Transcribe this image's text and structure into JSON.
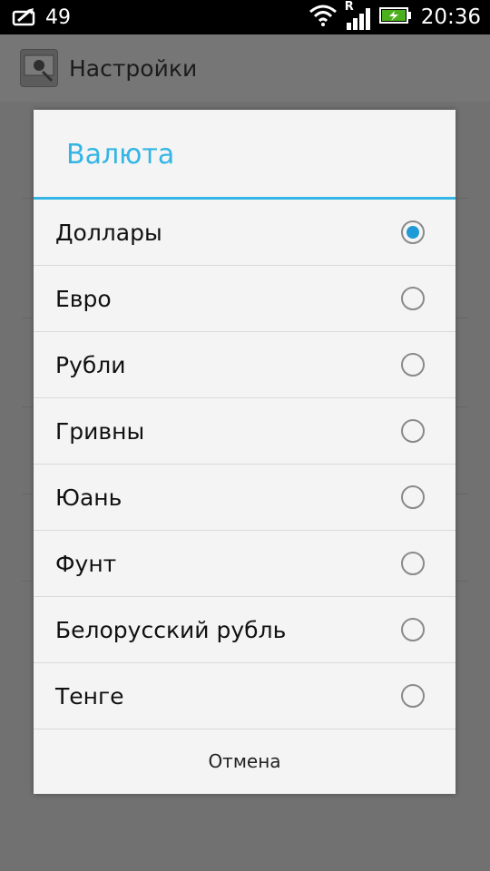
{
  "status_bar": {
    "notification_count": "49",
    "time": "20:36",
    "network_indicator": "R"
  },
  "app": {
    "title": "Настройки"
  },
  "dialog": {
    "title": "Валюта",
    "options": [
      {
        "label": "Доллары",
        "selected": true
      },
      {
        "label": "Евро",
        "selected": false
      },
      {
        "label": "Рубли",
        "selected": false
      },
      {
        "label": "Гривны",
        "selected": false
      },
      {
        "label": "Юань",
        "selected": false
      },
      {
        "label": "Фунт",
        "selected": false
      },
      {
        "label": "Белорусский рубль",
        "selected": false
      },
      {
        "label": "Тенге",
        "selected": false
      }
    ],
    "cancel_label": "Отмена"
  },
  "colors": {
    "accent": "#33b5e5",
    "radio_selected": "#1e9ad6",
    "battery_green": "#4caf1c"
  },
  "icons": [
    "notification-icon",
    "wifi-icon",
    "signal-icon",
    "battery-charging-icon",
    "app-settings-icon"
  ]
}
